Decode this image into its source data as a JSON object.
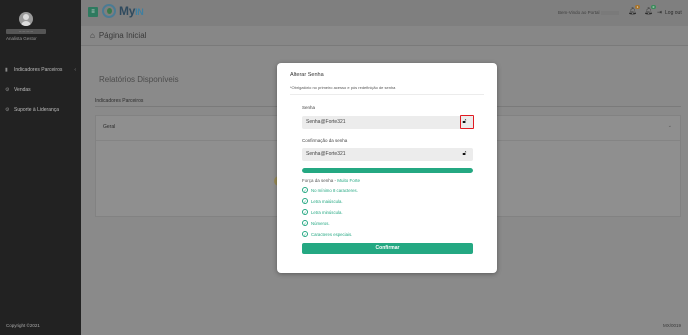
{
  "sidebar": {
    "user_name": "···········",
    "user_role": "Analista Gestor",
    "items": [
      {
        "label": "Indicadores Parceiros",
        "icon": "chart-icon"
      },
      {
        "label": "Vendas",
        "icon": "gear-icon"
      },
      {
        "label": "Suporte à Liderança",
        "icon": "gear-icon"
      }
    ],
    "copyright": "Copyright ©2021"
  },
  "topbar": {
    "logo_text": "My",
    "logo_accent": "IN",
    "welcome": "Bem-Vindo ao Portal",
    "notif_count_1": "1",
    "notif_count_2": "0",
    "logout": "Log out"
  },
  "breadcrumb": {
    "page_title": "Página Inicial"
  },
  "content": {
    "reports_title": "Relatórios Disponíveis",
    "panel_label": "Indicadores Parceiros",
    "card_title": "Geral",
    "version": "MX/0019"
  },
  "modal": {
    "title": "Alterar Senha",
    "subtitle": "*Obrigatório no primeiro acesso e pós redefinição de senha",
    "password_label": "Senha",
    "password_value": "Senha@Forte321",
    "confirm_label": "Confirmação da senha",
    "confirm_value": "Senha@Forte321",
    "strength_fraction": 1.0,
    "strength_label": "Força da senha - ",
    "strength_level": "Muito Forte",
    "rules": [
      "No mínimo 8 caracteres.",
      "Letra maiúscula.",
      "Letra minúscula.",
      "Números.",
      "Caracteres especiais."
    ],
    "confirm_button": "Confirmar"
  },
  "colors": {
    "accent": "#24a882",
    "highlight": "#e11b22"
  }
}
